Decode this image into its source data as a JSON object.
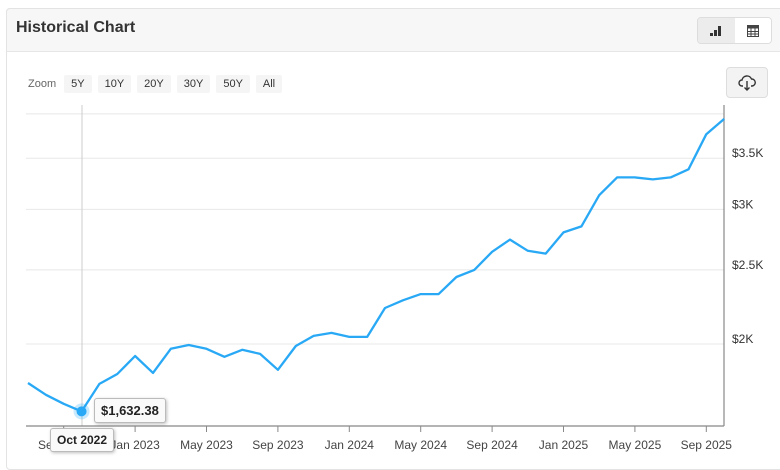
{
  "header": {
    "title": "Historical Chart"
  },
  "view_toggle": {
    "chart_icon": "bar-chart-icon",
    "table_icon": "table-grid-icon",
    "active": "chart"
  },
  "zoom": {
    "label": "Zoom",
    "options": [
      "5Y",
      "10Y",
      "20Y",
      "30Y",
      "50Y",
      "All"
    ]
  },
  "download": {
    "icon": "cloud-download-icon"
  },
  "tooltip": {
    "value": "$1,632.38",
    "date": "Oct 2022"
  },
  "colors": {
    "line": "#29a9f5",
    "grid": "#e8e8e8",
    "axis": "#888888"
  },
  "chart_data": {
    "type": "line",
    "title": "Historical Chart",
    "xlabel": "",
    "ylabel": "",
    "y_scale": "log",
    "ylim": [
      1562,
      4072
    ],
    "grid": true,
    "x": [
      "Jul 2022",
      "Aug 2022",
      "Sep 2022",
      "Oct 2022",
      "Nov 2022",
      "Dec 2022",
      "Jan 2023",
      "Feb 2023",
      "Mar 2023",
      "Apr 2023",
      "May 2023",
      "Jun 2023",
      "Jul 2023",
      "Aug 2023",
      "Sep 2023",
      "Oct 2023",
      "Nov 2023",
      "Dec 2023",
      "Jan 2024",
      "Feb 2024",
      "Mar 2024",
      "Apr 2024",
      "May 2024",
      "Jun 2024",
      "Jul 2024",
      "Aug 2024",
      "Sep 2024",
      "Oct 2024",
      "Nov 2024",
      "Dec 2024",
      "Jan 2025",
      "Feb 2025",
      "Mar 2025",
      "Apr 2025",
      "May 2025",
      "Jun 2025",
      "Jul 2025",
      "Aug 2025",
      "Sep 2025",
      "Oct 2025"
    ],
    "values": [
      1778,
      1716,
      1670,
      1632.38,
      1773,
      1827,
      1929,
      1833,
      1971,
      1994,
      1971,
      1924,
      1965,
      1941,
      1850,
      1988,
      2049,
      2068,
      2043,
      2043,
      2229,
      2281,
      2324,
      2324,
      2447,
      2500,
      2640,
      2739,
      2648,
      2626,
      2799,
      2850,
      3131,
      3304,
      3304,
      3284,
      3304,
      3385,
      3763,
      3941
    ],
    "x_ticks": [
      {
        "label": "Sep 2022",
        "index": 2
      },
      {
        "label": "Jan 2023",
        "index": 6
      },
      {
        "label": "May 2023",
        "index": 10
      },
      {
        "label": "Sep 2023",
        "index": 14
      },
      {
        "label": "Jan 2024",
        "index": 18
      },
      {
        "label": "May 2024",
        "index": 22
      },
      {
        "label": "Sep 2024",
        "index": 26
      },
      {
        "label": "Jan 2025",
        "index": 30
      },
      {
        "label": "May 2025",
        "index": 34
      },
      {
        "label": "Sep 2025",
        "index": 38
      }
    ],
    "y_ticks": [
      {
        "label": "$2K",
        "value": 2000
      },
      {
        "label": "$2.5K",
        "value": 2500
      },
      {
        "label": "$3K",
        "value": 3000
      },
      {
        "label": "$3.5K",
        "value": 3500
      },
      {
        "label": "",
        "value": 4000
      }
    ],
    "highlight_index": 3
  }
}
